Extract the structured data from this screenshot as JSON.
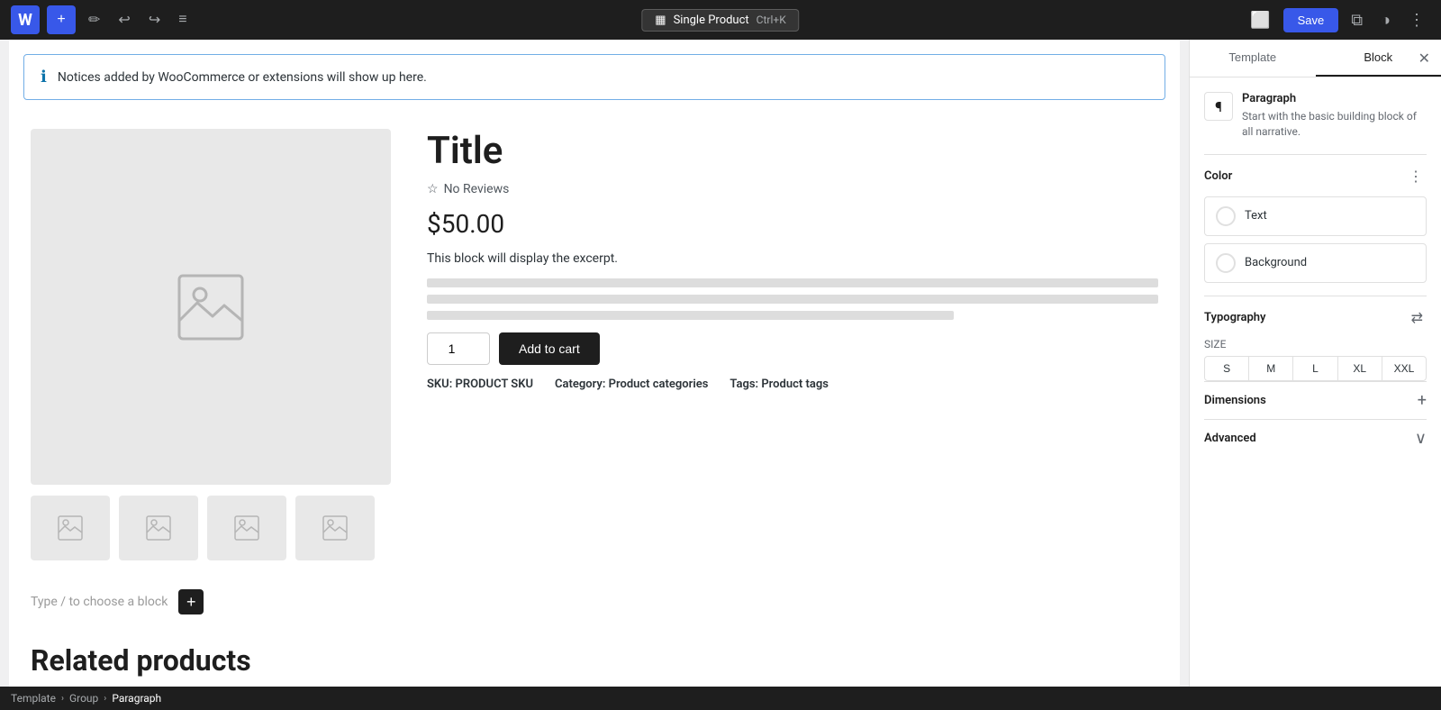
{
  "toolbar": {
    "wp_logo": "W",
    "add_label": "+",
    "edit_label": "✏",
    "undo_label": "↩",
    "redo_label": "↪",
    "more_label": "≡",
    "template_name": "Single Product",
    "shortcut": "Ctrl+K",
    "save_label": "Save",
    "template_icon": "▦"
  },
  "notice": {
    "text": "Notices added by WooCommerce or extensions will show up here."
  },
  "product": {
    "title": "Title",
    "reviews": "No Reviews",
    "price": "$50.00",
    "excerpt": "This block will display the excerpt.",
    "qty": "1",
    "add_to_cart": "Add to cart",
    "sku_label": "SKU:",
    "sku_value": "PRODUCT SKU",
    "category_label": "Category:",
    "category_value": "Product categories",
    "tags_label": "Tags:",
    "tags_value": "Product tags"
  },
  "add_block": {
    "placeholder": "Type / to choose a block"
  },
  "related": {
    "title": "Related products"
  },
  "sidebar": {
    "tab_template": "Template",
    "tab_block": "Block",
    "block_title": "Paragraph",
    "block_description": "Start with the basic building block of all narrative.",
    "color_section": "Color",
    "text_label": "Text",
    "background_label": "Background",
    "typography_section": "Typography",
    "size_section": "SIZE",
    "sizes": [
      "S",
      "M",
      "L",
      "XL",
      "XXL"
    ],
    "dimensions_section": "Dimensions",
    "advanced_section": "Advanced"
  },
  "breadcrumb": {
    "items": [
      "Template",
      "Group",
      "Paragraph"
    ]
  }
}
